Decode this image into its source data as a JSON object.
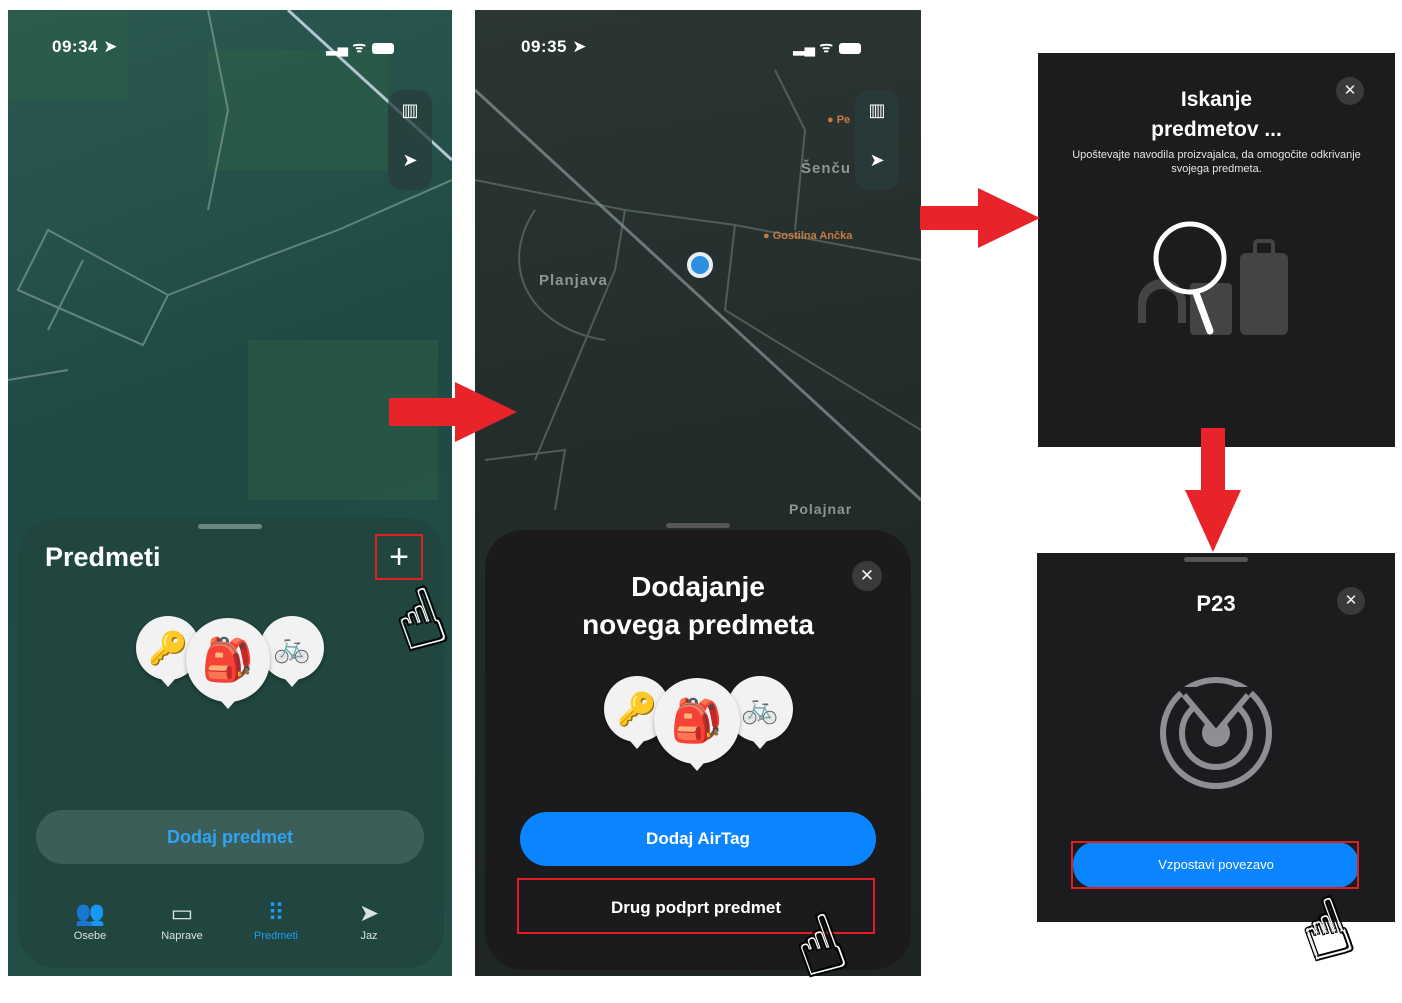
{
  "panel1": {
    "time": "09:34",
    "sheet_title": "Predmeti",
    "add_icon": "+",
    "add_item_button": "Dodaj predmet",
    "tabs": [
      {
        "label": "Osebe",
        "icon": "people-icon"
      },
      {
        "label": "Naprave",
        "icon": "devices-icon"
      },
      {
        "label": "Predmeti",
        "icon": "items-icon"
      },
      {
        "label": "Jaz",
        "icon": "location-arrow-icon"
      }
    ],
    "active_tab": "Predmeti"
  },
  "panel2": {
    "time": "09:35",
    "map_labels": {
      "place1": "Planjava",
      "place2": "Šenču",
      "place3": "Polajnar",
      "poi1": "Gostilna Ančka",
      "poi2": "Pe"
    },
    "sheet_title_line1": "Dodajanje",
    "sheet_title_line2": "novega predmeta",
    "airtag_button": "Dodaj AirTag",
    "other_item_button": "Drug podprt predmet",
    "close": "✕"
  },
  "panel3": {
    "title_line1": "Iskanje",
    "title_line2": "predmetov ...",
    "subtitle": "Upoštevajte navodila proizvajalca, da omogočite odkrivanje svojega predmeta.",
    "close": "✕"
  },
  "panel4": {
    "title": "P23",
    "connect_button": "Vzpostavi povezavo",
    "close": "✕"
  },
  "colors": {
    "accent_blue": "#0a84ff",
    "highlight_red": "#e02020",
    "arrow_red": "#e8232a"
  }
}
